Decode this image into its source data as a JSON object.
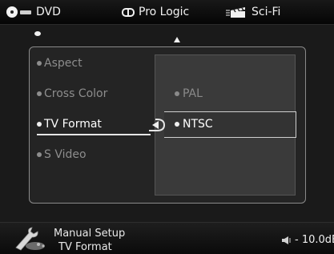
{
  "status_bar": {
    "source_label": "DVD",
    "audio_label": "Pro Logic",
    "mode_label": "Sci-Fi",
    "icons": [
      "disc-icon",
      "dolby-icon",
      "clapper-icon"
    ]
  },
  "menu": {
    "items": [
      {
        "label": "Aspect",
        "active": false
      },
      {
        "label": "Cross Color",
        "active": false
      },
      {
        "label": "TV Format",
        "active": true
      },
      {
        "label": "S Video",
        "active": false
      }
    ]
  },
  "submenu": {
    "options": [
      {
        "label": "PAL",
        "selected": false
      },
      {
        "label": "NTSC",
        "selected": true
      }
    ]
  },
  "footer": {
    "title": "Manual Setup",
    "subtitle": "TV Format",
    "volume": "- 10.0dB"
  },
  "colors": {
    "background": "#1a1a1a",
    "active_text": "#ffffff",
    "inactive_text": "#8d8d8d"
  }
}
